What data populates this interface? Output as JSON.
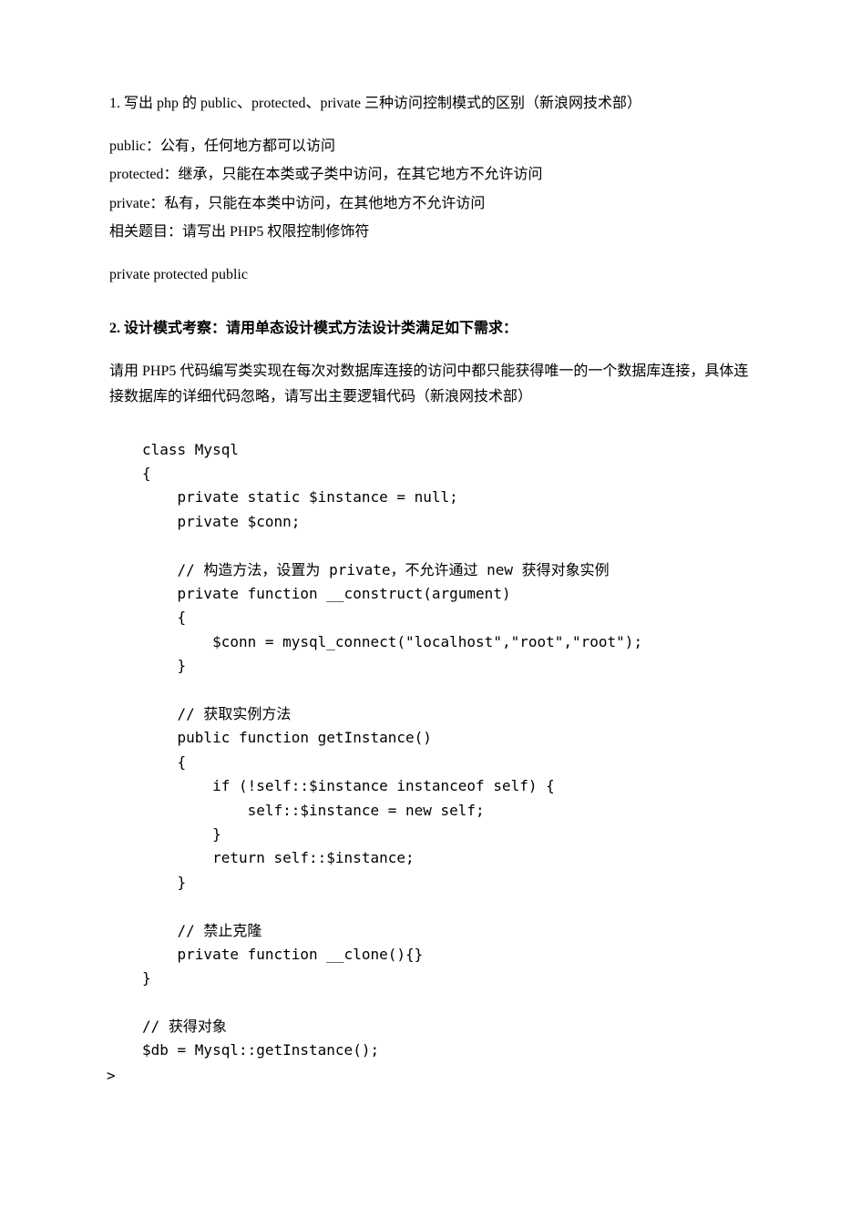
{
  "q1": {
    "title": "1. 写出 php 的 public、protected、private 三种访问控制模式的区别（新浪网技术部）",
    "a1": "public：公有，任何地方都可以访问",
    "a2": "protected：继承，只能在本类或子类中访问，在其它地方不允许访问",
    "a3": "private：私有，只能在本类中访问，在其他地方不允许访问",
    "a4": "相关题目：请写出 PHP5 权限控制修饰符",
    "a5": "private protected public"
  },
  "q2": {
    "title": "2. 设计模式考察：请用单态设计模式方法设计类满足如下需求：",
    "desc": "请用 PHP5 代码编写类实现在每次对数据库连接的访问中都只能获得唯一的一个数据库连接，具体连接数据库的详细代码忽略，请写出主要逻辑代码（新浪网技术部）",
    "code": "class Mysql\n{\n    private static $instance = null;\n    private $conn;\n\n    // 构造方法，设置为 private，不允许通过 new 获得对象实例\n    private function __construct(argument)\n    {\n        $conn = mysql_connect(\"localhost\",\"root\",\"root\");\n    }\n\n    // 获取实例方法\n    public function getInstance()\n    {\n        if (!self::$instance instanceof self) {\n            self::$instance = new self;\n        }\n        return self::$instance;\n    }\n\n    // 禁止克隆\n    private function __clone(){}\n}\n\n// 获得对象\n$db = Mysql::getInstance();",
    "arrow": ">"
  }
}
